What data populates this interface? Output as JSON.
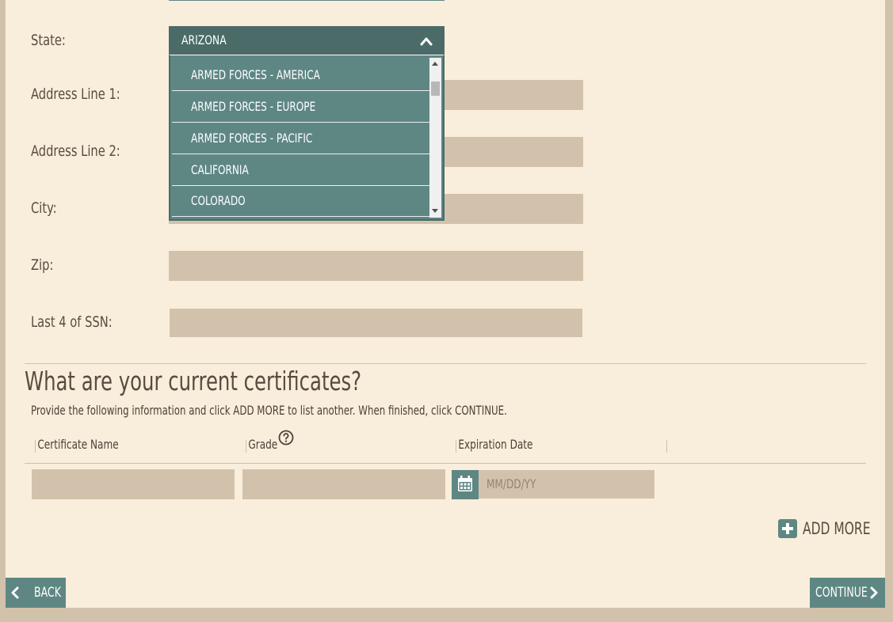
{
  "form": {
    "state_label": "State:",
    "state_value": "ARIZONA",
    "address1_label": "Address Line 1:",
    "address2_label": "Address Line 2:",
    "city_label": "City:",
    "zip_label": "Zip:",
    "ssn_label": "Last 4 of SSN:"
  },
  "state_dropdown": {
    "options": [
      "ARMED FORCES - AMERICA",
      "ARMED FORCES - EUROPE",
      "ARMED FORCES - PACIFIC",
      "CALIFORNIA",
      "COLORADO"
    ]
  },
  "certificates": {
    "title": "What are your current certificates?",
    "instructions": "Provide the following information and click ADD MORE to list another. When finished, click CONTINUE.",
    "columns": [
      "Certificate Name",
      "Grade",
      "Expiration Date"
    ],
    "date_placeholder": "MM/DD/YY",
    "add_more_label": "ADD MORE"
  },
  "nav": {
    "back_label": "BACK",
    "continue_label": "CONTINUE"
  },
  "colors": {
    "background": "#f9eedb",
    "outer": "#d3c2ab",
    "input_fill": "#d3c2ab",
    "accent": "#5e8784",
    "accent_dark": "#4b6b69",
    "text": "#4f3f36"
  },
  "icons": {
    "select_toggle": "chevron-up-icon",
    "help": "question-circle-icon",
    "calendar": "calendar-icon",
    "add": "plus-square-icon",
    "back": "chevron-left-icon",
    "continue": "chevron-right-icon"
  }
}
